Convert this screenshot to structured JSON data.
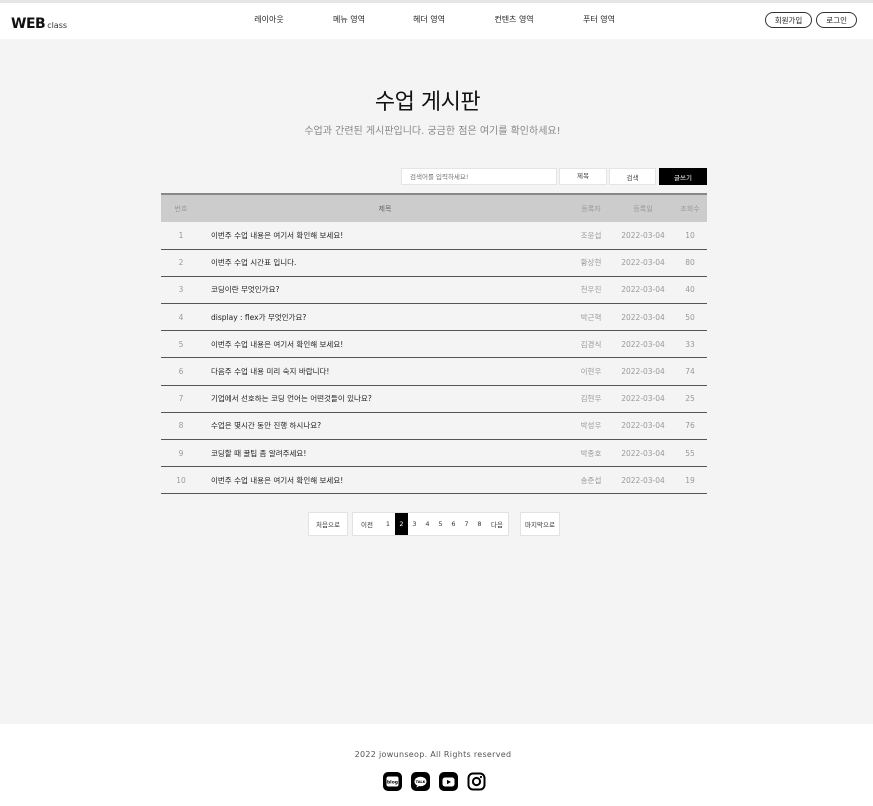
{
  "header": {
    "logo_main": "WEB",
    "logo_sub": "class",
    "nav": [
      {
        "label": "레이아웃"
      },
      {
        "label": "메뉴 영역"
      },
      {
        "label": "헤더 영역"
      },
      {
        "label": "컨텐츠 영역"
      },
      {
        "label": "푸터 영역"
      }
    ],
    "signup_label": "회원가입",
    "login_label": "로그인"
  },
  "board": {
    "title": "수업 게시판",
    "subtitle": "수업과 간련된 게시판입니다. 궁금한 점은 여기를 확인하세요!",
    "search_placeholder": "검색어를 입력하세요!",
    "search_value": "검색어를 입력하세요!",
    "select_value": "제목",
    "search_label": "검색",
    "write_label": "글쓰기",
    "columns": [
      "번호",
      "제목",
      "등록자",
      "등록일",
      "조회수"
    ],
    "rows": [
      {
        "num": "1",
        "title": "이번주 수업 내용은 여기서 확인해 보세요!",
        "author": "조윤섭",
        "date": "2022-03-04",
        "views": "10"
      },
      {
        "num": "2",
        "title": "이번주 수업 시간표 입니다.",
        "author": "황상현",
        "date": "2022-03-04",
        "views": "80"
      },
      {
        "num": "3",
        "title": "코딩이란 무엇인가요?",
        "author": "천우진",
        "date": "2022-03-04",
        "views": "40"
      },
      {
        "num": "4",
        "title": "display : flex가 무엇인가요?",
        "author": "박근혁",
        "date": "2022-03-04",
        "views": "50"
      },
      {
        "num": "5",
        "title": "이번주 수업 내용은 여기서 확인해 보세요!",
        "author": "김경식",
        "date": "2022-03-04",
        "views": "33"
      },
      {
        "num": "6",
        "title": "다음주 수업 내용 미리 숙지 바랍니다!",
        "author": "이현우",
        "date": "2022-03-04",
        "views": "74"
      },
      {
        "num": "7",
        "title": "기업에서 선호하는 코딩 언어는 어떤것들이 있나요?",
        "author": "김현우",
        "date": "2022-03-04",
        "views": "25"
      },
      {
        "num": "8",
        "title": "수업은 몇시간 동안 진행 하시나요?",
        "author": "박성우",
        "date": "2022-03-04",
        "views": "76"
      },
      {
        "num": "9",
        "title": "코딩할 때 꿀팁 좀 알려주세요!",
        "author": "박종호",
        "date": "2022-03-04",
        "views": "55"
      },
      {
        "num": "10",
        "title": "이번주 수업 내용은 여기서 확인해 보세요!",
        "author": "송준섭",
        "date": "2022-03-04",
        "views": "19"
      }
    ]
  },
  "pagination": {
    "first_label": "처음으로",
    "prev_label": "이전",
    "pages": [
      "1",
      "2",
      "3",
      "4",
      "5",
      "6",
      "7",
      "8"
    ],
    "current_page": "2",
    "next_label": "다음",
    "last_label": "마지막으로"
  },
  "footer": {
    "copyright": "2022 jowunseop. All Rights reserved",
    "social": [
      "blog-icon",
      "kakaotalk-icon",
      "youtube-icon",
      "instagram-icon"
    ]
  }
}
